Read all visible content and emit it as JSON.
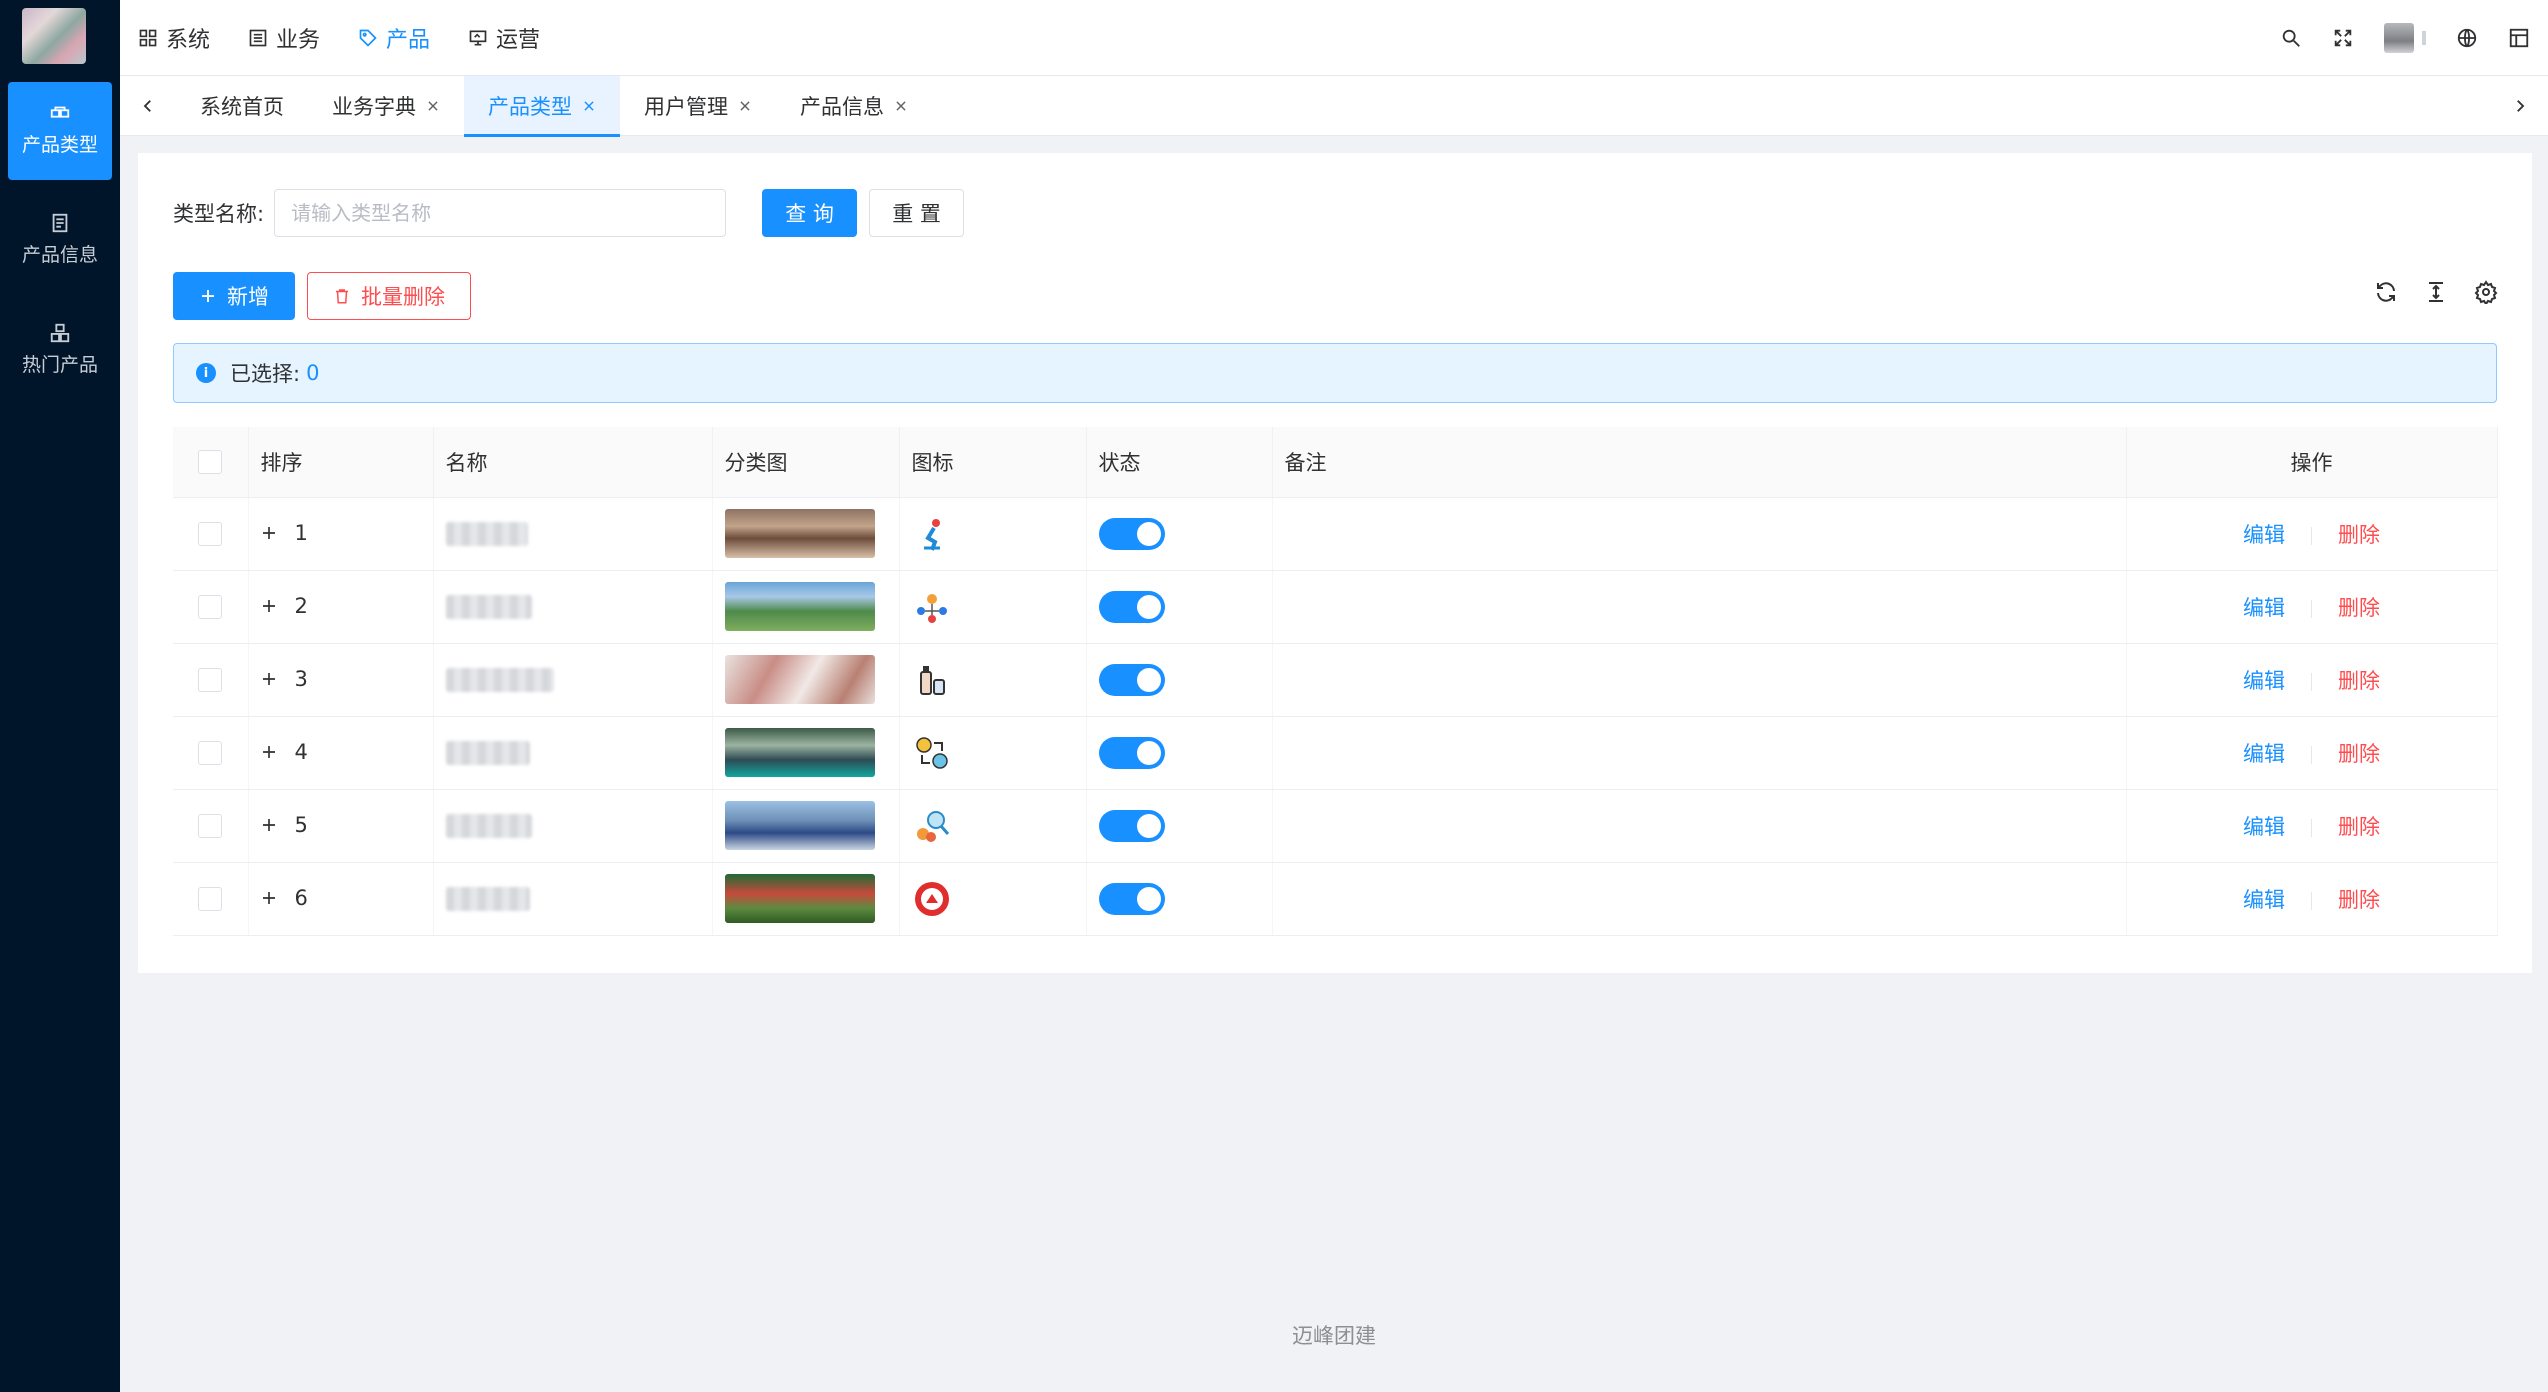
{
  "sidebar": {
    "items": [
      {
        "label": "产品类型",
        "icon": "product-type-icon",
        "active": true
      },
      {
        "label": "产品信息",
        "icon": "document-icon",
        "active": false
      },
      {
        "label": "热门产品",
        "icon": "hot-product-icon",
        "active": false
      }
    ]
  },
  "topmenu": {
    "items": [
      {
        "label": "系统",
        "icon": "grid-icon"
      },
      {
        "label": "业务",
        "icon": "list-icon"
      },
      {
        "label": "产品",
        "icon": "tag-icon",
        "active": true
      },
      {
        "label": "运营",
        "icon": "monitor-icon"
      }
    ]
  },
  "tabs": [
    {
      "label": "系统首页",
      "closable": false
    },
    {
      "label": "业务字典",
      "closable": true
    },
    {
      "label": "产品类型",
      "closable": true,
      "active": true
    },
    {
      "label": "用户管理",
      "closable": true
    },
    {
      "label": "产品信息",
      "closable": true
    }
  ],
  "search": {
    "label": "类型名称:",
    "placeholder": "请输入类型名称",
    "value": "",
    "query_label": "查 询",
    "reset_label": "重 置"
  },
  "toolbar": {
    "add_label": "新增",
    "batch_delete_label": "批量删除"
  },
  "alert": {
    "text": "已选择:",
    "count": "0"
  },
  "table": {
    "columns": [
      "排序",
      "名称",
      "分类图",
      "图标",
      "状态",
      "备注",
      "操作"
    ],
    "rows": [
      {
        "sort": "1",
        "image": "t1",
        "icon": "skating-icon",
        "status": true,
        "remark": ""
      },
      {
        "sort": "2",
        "image": "t2",
        "icon": "network-people-icon",
        "status": true,
        "remark": ""
      },
      {
        "sort": "3",
        "image": "t3",
        "icon": "bottles-icon",
        "status": true,
        "remark": ""
      },
      {
        "sort": "4",
        "image": "t4",
        "icon": "exchange-icon",
        "status": true,
        "remark": ""
      },
      {
        "sort": "5",
        "image": "t5",
        "icon": "search-people-icon",
        "status": true,
        "remark": ""
      },
      {
        "sort": "6",
        "image": "t6",
        "icon": "party-emblem-icon",
        "status": true,
        "remark": ""
      }
    ],
    "edit_label": "编辑",
    "delete_label": "删除"
  },
  "footer": {
    "text": "迈峰团建"
  },
  "colors": {
    "primary": "#1890ff",
    "danger": "#ff4d4f",
    "sidebar_bg": "#001529"
  }
}
